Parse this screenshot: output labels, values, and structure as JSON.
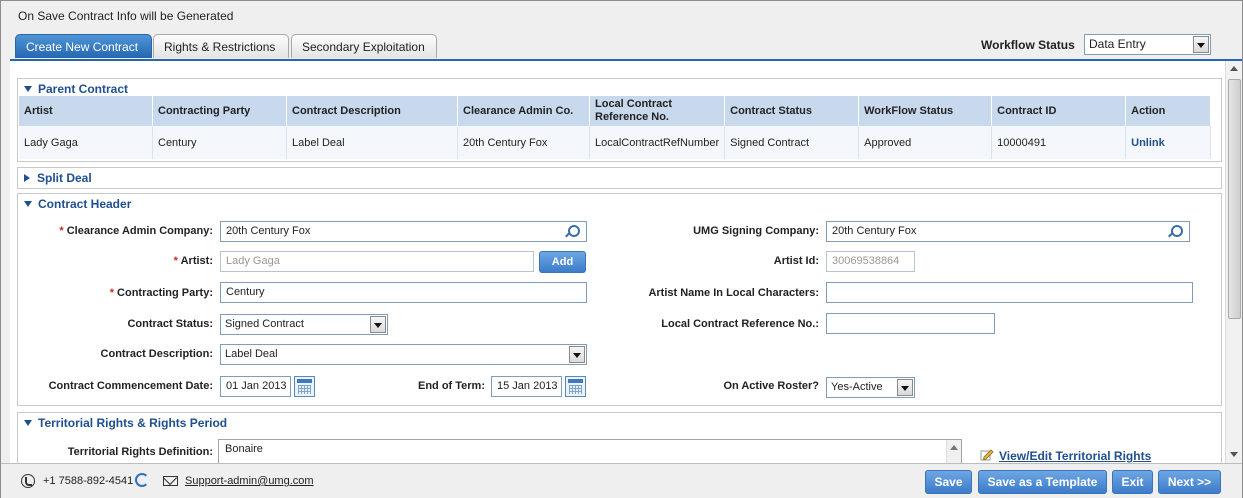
{
  "top_message": "On Save Contract Info will be Generated",
  "tabs": [
    {
      "label": "Create New Contract",
      "active": true
    },
    {
      "label": "Rights & Restrictions",
      "active": false
    },
    {
      "label": "Secondary Exploitation",
      "active": false
    }
  ],
  "workflow": {
    "label": "Workflow Status",
    "value": "Data Entry"
  },
  "parent_contract": {
    "title": "Parent Contract",
    "columns": [
      "Artist",
      "Contracting Party",
      "Contract Description",
      "Clearance Admin Co.",
      "Local Contract Reference No.",
      "Contract Status",
      "WorkFlow Status",
      "Contract ID",
      "Action"
    ],
    "rows": [
      [
        "Lady Gaga",
        "Century",
        "Label Deal",
        "20th Century Fox",
        "LocalContractRefNumber",
        "Signed Contract",
        "Approved",
        "10000491",
        "Unlink"
      ]
    ]
  },
  "split_deal": {
    "title": "Split Deal"
  },
  "contract_header": {
    "title": "Contract Header",
    "required_mark": "*",
    "clearance_admin_company": {
      "label": "Clearance Admin Company:",
      "value": "20th Century Fox"
    },
    "artist": {
      "label": "Artist:",
      "value": "Lady Gaga",
      "add_button": "Add"
    },
    "contracting_party": {
      "label": "Contracting Party:",
      "value": "Century"
    },
    "contract_status": {
      "label": "Contract Status:",
      "value": "Signed Contract"
    },
    "contract_description": {
      "label": "Contract Description:",
      "value": "Label Deal"
    },
    "commencement_date": {
      "label": "Contract Commencement Date:",
      "value": "01 Jan 2013"
    },
    "end_of_term": {
      "label": "End of Term:",
      "value": "15 Jan 2013"
    },
    "umg_signing_company": {
      "label": "UMG Signing Company:",
      "value": "20th Century Fox"
    },
    "artist_id": {
      "label": "Artist Id:",
      "value": "30069538864"
    },
    "artist_name_local": {
      "label": "Artist Name In Local Characters:",
      "value": ""
    },
    "local_contract_ref": {
      "label": "Local Contract Reference No.:",
      "value": ""
    },
    "on_active_roster": {
      "label": "On Active Roster?",
      "value": "Yes-Active"
    }
  },
  "territorial": {
    "title": "Territorial Rights & Rights Period",
    "definition_label": "Territorial Rights Definition:",
    "definition_value": "Bonaire",
    "view_edit_link": "View/Edit Territorial Rights"
  },
  "footer": {
    "phone": "+1 7588-892-4541",
    "email": "Support-admin@umg.com",
    "buttons": {
      "save": "Save",
      "save_template": "Save as a Template",
      "exit": "Exit",
      "next": "Next >>"
    }
  }
}
